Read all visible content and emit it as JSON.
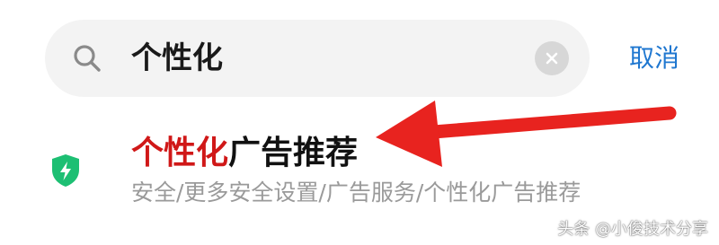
{
  "search": {
    "query": "个性化",
    "cancel_label": "取消"
  },
  "result": {
    "title_highlight": "个性化",
    "title_rest": "广告推荐",
    "path": "安全/更多安全设置/广告服务/个性化广告推荐"
  },
  "watermark": {
    "text": "头条 @小俊技术分享"
  },
  "colors": {
    "highlight": "#d01818",
    "accent": "#1f77d0",
    "shield": "#1dbf73",
    "arrow": "#e8231f"
  },
  "icons": {
    "search": "search-icon",
    "clear": "close-icon",
    "shield": "shield-icon",
    "arrow": "arrow-icon"
  }
}
